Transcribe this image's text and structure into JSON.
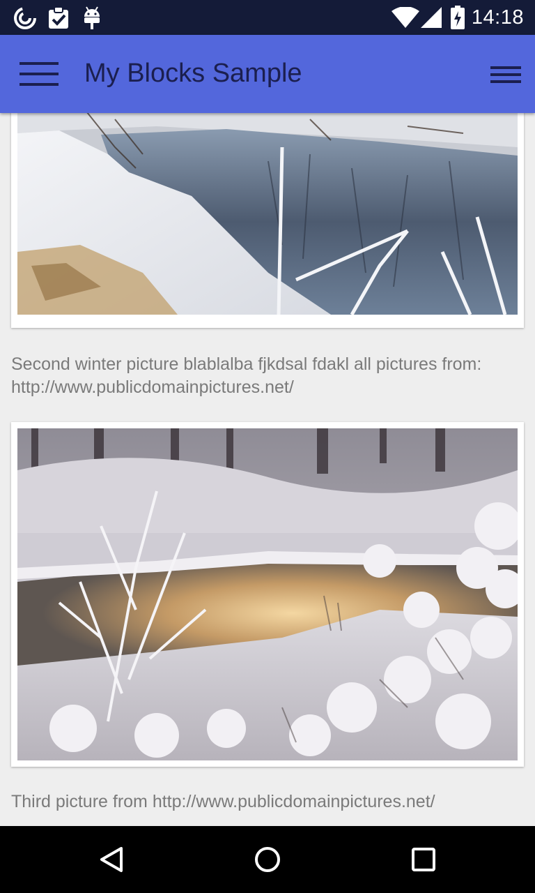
{
  "status_bar": {
    "time": "14:18",
    "left_icons": [
      "sync-icon",
      "clipboard-check-icon",
      "android-icon"
    ],
    "right_icons": [
      "wifi-icon",
      "cell-signal-icon",
      "battery-icon"
    ]
  },
  "toolbar": {
    "title": "My Blocks Sample",
    "left_icon": "hamburger-menu-icon",
    "right_icon": "overflow-menu-icon",
    "background": "#5367dc"
  },
  "cards": [
    {
      "photo": "winter-river-snowy-bank",
      "caption": "Second winter picture blablalba fjkdsal fdakl all pictures from: http://www.publicdomainpictures.net/"
    },
    {
      "photo": "frosted-bushes-sunset-river",
      "caption": "Third picture from http://www.publicdomainpictures.net/"
    }
  ],
  "nav_bar": {
    "icons": [
      "back-icon",
      "home-icon",
      "recents-icon"
    ]
  }
}
